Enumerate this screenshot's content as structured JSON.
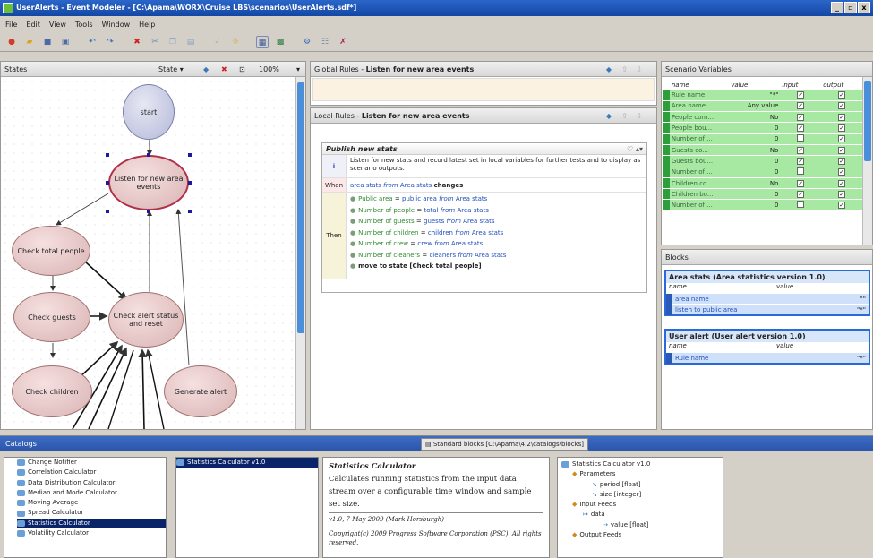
{
  "window": {
    "title": "UserAlerts - Event Modeler - [C:\\Apama\\WORX\\Cruise LBS\\scenarios\\UserAlerts.sdf*]",
    "controls": [
      "_",
      "ř",
      "x"
    ]
  },
  "menu": [
    "File",
    "Edit",
    "View",
    "Tools",
    "Window",
    "Help"
  ],
  "states_panel": {
    "title": "States",
    "state_dropdown": "State",
    "zoom": "100%",
    "nodes": {
      "start": "start",
      "listen": "Listen for new area events",
      "check_total": "Check total people",
      "check_guests": "Check guests",
      "check_alert": "Check alert status and reset",
      "check_children": "Check children",
      "generate_alert": "Generate alert"
    }
  },
  "global_rules": {
    "prefix": "Global Rules - ",
    "state": "Listen for new area events"
  },
  "local_rules": {
    "prefix": "Local Rules - ",
    "state": "Listen for new area events",
    "rule": {
      "name": "Publish new stats",
      "info_label": "i",
      "description": "Listen for new stats and record latest set in local variables for further tests and to display as scenario outputs.",
      "when_label": "When",
      "when": {
        "subject": "area stats",
        "from": "from",
        "source": "Area stats",
        "verb": "changes"
      },
      "then_label": "Then",
      "actions": [
        {
          "var": "Public area",
          "eq": "=",
          "field": "public area",
          "from": "from",
          "src": "Area stats"
        },
        {
          "var": "Number of people",
          "eq": "=",
          "field": "total",
          "from": "from",
          "src": "Area stats"
        },
        {
          "var": "Number of guests",
          "eq": "=",
          "field": "guests",
          "from": "from",
          "src": "Area stats"
        },
        {
          "var": "Number of children",
          "eq": "=",
          "field": "children",
          "from": "from",
          "src": "Area stats"
        },
        {
          "var": "Number of crew",
          "eq": "=",
          "field": "crew",
          "from": "from",
          "src": "Area stats"
        },
        {
          "var": "Number of cleaners",
          "eq": "=",
          "field": "cleaners",
          "from": "from",
          "src": "Area stats"
        }
      ],
      "final_action": "move to state [Check total people]"
    }
  },
  "scenario_variables": {
    "title": "Scenario Variables",
    "columns": [
      "name",
      "value",
      "input",
      "output"
    ],
    "rows": [
      {
        "name": "Rule name",
        "value": "\"*\"",
        "input": true,
        "output": true
      },
      {
        "name": "Area name",
        "value": "Any value",
        "input": true,
        "output": true
      },
      {
        "name": "People com...",
        "value": "No",
        "input": true,
        "output": true
      },
      {
        "name": "People bou...",
        "value": "0",
        "input": true,
        "output": true
      },
      {
        "name": "Number of ...",
        "value": "0",
        "input": false,
        "output": true
      },
      {
        "name": "Guests co...",
        "value": "No",
        "input": true,
        "output": true
      },
      {
        "name": "Guests bou...",
        "value": "0",
        "input": true,
        "output": true
      },
      {
        "name": "Number of ...",
        "value": "0",
        "input": false,
        "output": true
      },
      {
        "name": "Children co...",
        "value": "No",
        "input": true,
        "output": true
      },
      {
        "name": "Children bo...",
        "value": "0",
        "input": true,
        "output": true
      },
      {
        "name": "Number of ...",
        "value": "0",
        "input": false,
        "output": true
      }
    ]
  },
  "blocks": {
    "title": "Blocks",
    "items": [
      {
        "title": "Area stats (Area statistics version 1.0)",
        "col_name": "name",
        "col_value": "value",
        "rows": [
          {
            "name": "area name",
            "value": "\"\""
          },
          {
            "name": "listen to public area",
            "value": "\"*\""
          }
        ]
      },
      {
        "title": "User alert (User alert version 1.0)",
        "col_name": "name",
        "col_value": "value",
        "rows": [
          {
            "name": "Rule name",
            "value": "\"*\""
          }
        ]
      }
    ]
  },
  "catalogs": {
    "title": "Catalogs",
    "path": "Standard blocks [C:\\Apama\\4.2\\catalogs\\blocks]",
    "list": [
      "Change Notifier",
      "Correlation Calculator",
      "Data Distribution Calculator",
      "Median and Mode Calculator",
      "Moving Average",
      "Spread Calculator",
      "Statistics Calculator",
      "Volatility Calculator"
    ],
    "selected_index": 6,
    "versions": [
      "Statistics Calculator v1.0"
    ],
    "desc_title": "Statistics Calculator",
    "desc_body": "Calculates running statistics from the input data stream over a configurable time window and sample set size.",
    "desc_meta": "v1.0, 7 May 2009 (Mark Horsburgh)",
    "desc_copy": "Copyright(c) 2009 Progress Software Corporation (PSC). All rights reserved.",
    "tree": {
      "root": "Statistics Calculator v1.0",
      "parameters": "Parameters",
      "p1": "period [float]",
      "p2": "size [integer]",
      "input_feeds": "Input Feeds",
      "data": "data",
      "value": "value [float]",
      "output_feeds": "Output Feeds"
    }
  },
  "colors": {
    "accent": "#2a6ad8",
    "node_fill": "#e8c8c8",
    "node_border": "#b0304a",
    "var_green": "#a7e8a3"
  }
}
